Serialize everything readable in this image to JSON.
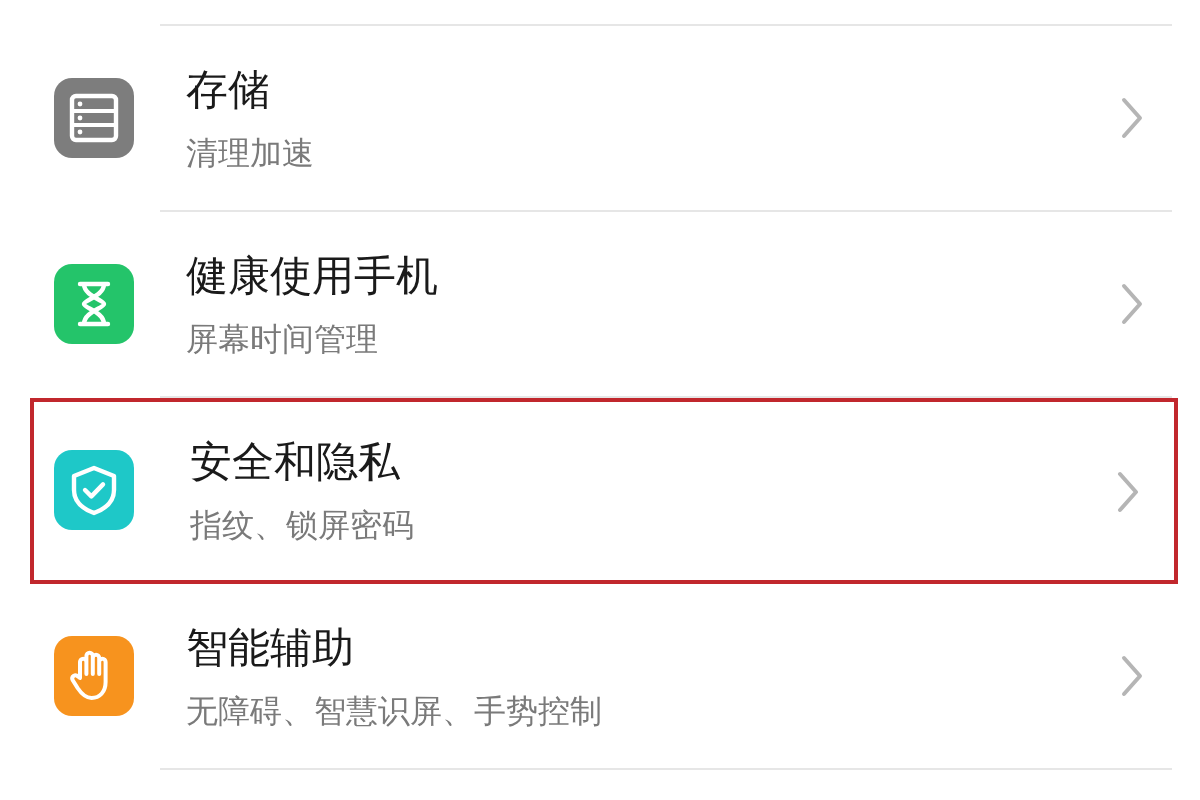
{
  "items": [
    {
      "kind": "storage",
      "title": "存储",
      "subtitle": "清理加速",
      "highlighted": false
    },
    {
      "kind": "health",
      "title": "健康使用手机",
      "subtitle": "屏幕时间管理",
      "highlighted": false
    },
    {
      "kind": "security",
      "title": "安全和隐私",
      "subtitle": "指纹、锁屏密码",
      "highlighted": true
    },
    {
      "kind": "assist",
      "title": "智能辅助",
      "subtitle": "无障碍、智慧识屏、手势控制",
      "highlighted": false
    }
  ]
}
